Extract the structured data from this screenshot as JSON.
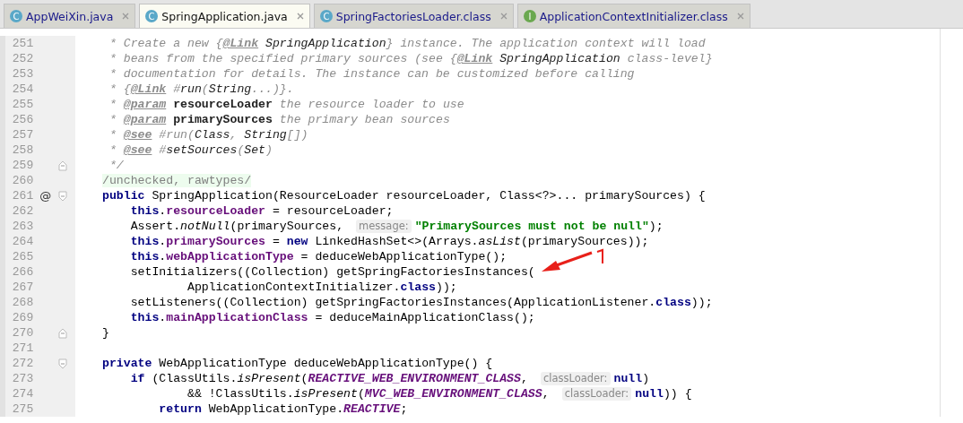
{
  "tabs": [
    {
      "label": "AppWeiXin.java",
      "icon_letter": "C",
      "kind": "class",
      "selected": false
    },
    {
      "label": "SpringApplication.java",
      "icon_letter": "C",
      "kind": "class",
      "selected": true
    },
    {
      "label": "SpringFactoriesLoader.class",
      "icon_letter": "C",
      "kind": "class",
      "selected": false
    },
    {
      "label": "ApplicationContextInitializer.class",
      "icon_letter": "I",
      "kind": "interface",
      "selected": false
    }
  ],
  "lines": [
    {
      "number": "251",
      "tokens": [
        {
          "t": " * Create a new {",
          "kind": "comment"
        },
        {
          "t": "@Link",
          "kind": "doctag"
        },
        {
          "t": " SpringApplication",
          "kind": "docref"
        },
        {
          "t": "} instance. The application context will load",
          "kind": "comment"
        }
      ]
    },
    {
      "number": "252",
      "tokens": [
        {
          "t": " * beans from the specified primary sources (see {",
          "kind": "comment"
        },
        {
          "t": "@Link",
          "kind": "doctag"
        },
        {
          "t": " SpringApplication",
          "kind": "docref"
        },
        {
          "t": " class-level}",
          "kind": "comment"
        }
      ]
    },
    {
      "number": "253",
      "tokens": [
        {
          "t": " * documentation for details. The instance can be customized before calling",
          "kind": "comment"
        }
      ]
    },
    {
      "number": "254",
      "tokens": [
        {
          "t": " * {",
          "kind": "comment"
        },
        {
          "t": "@Link",
          "kind": "doctag"
        },
        {
          "t": " #",
          "kind": "comment"
        },
        {
          "t": "run",
          "kind": "docref"
        },
        {
          "t": "(",
          "kind": "comment"
        },
        {
          "t": "String",
          "kind": "docref"
        },
        {
          "t": "...)}.",
          "kind": "comment"
        }
      ]
    },
    {
      "number": "255",
      "tokens": [
        {
          "t": " * ",
          "kind": "comment"
        },
        {
          "t": "@param",
          "kind": "doctag"
        },
        {
          "t": " resourceLoader",
          "kind": "docparam"
        },
        {
          "t": " the resource loader to use",
          "kind": "comment"
        }
      ]
    },
    {
      "number": "256",
      "tokens": [
        {
          "t": " * ",
          "kind": "comment"
        },
        {
          "t": "@param",
          "kind": "doctag"
        },
        {
          "t": " primarySources",
          "kind": "docparam"
        },
        {
          "t": " the primary bean sources",
          "kind": "comment"
        }
      ]
    },
    {
      "number": "257",
      "tokens": [
        {
          "t": " * ",
          "kind": "comment"
        },
        {
          "t": "@see",
          "kind": "doctag"
        },
        {
          "t": " #run(",
          "kind": "comment"
        },
        {
          "t": "Class",
          "kind": "docref"
        },
        {
          "t": ", ",
          "kind": "comment"
        },
        {
          "t": "String",
          "kind": "docref"
        },
        {
          "t": "[])",
          "kind": "comment"
        }
      ]
    },
    {
      "number": "258",
      "tokens": [
        {
          "t": " * ",
          "kind": "comment"
        },
        {
          "t": "@see",
          "kind": "doctag"
        },
        {
          "t": " #",
          "kind": "comment"
        },
        {
          "t": "setSources",
          "kind": "docref"
        },
        {
          "t": "(",
          "kind": "comment"
        },
        {
          "t": "Set",
          "kind": "docref"
        },
        {
          "t": ")",
          "kind": "comment"
        }
      ]
    },
    {
      "number": "259",
      "fold": {
        "kind": "end"
      },
      "tokens": [
        {
          "t": " */",
          "kind": "comment"
        }
      ]
    },
    {
      "number": "260",
      "tokens": [
        {
          "t": "/unchecked, rawtypes/",
          "kind": "annotation"
        }
      ]
    },
    {
      "number": "261",
      "gutter_mark": "@",
      "fold": {
        "kind": "start"
      },
      "tokens": [
        {
          "t": "public",
          "kind": "keyword"
        },
        {
          "t": " SpringApplication(ResourceLoader resourceLoader, Class<?>... primarySources) {",
          "kind": "plain"
        }
      ]
    },
    {
      "number": "262",
      "tokens": [
        {
          "t": "    this",
          "kind": "keyword"
        },
        {
          "t": ".",
          "kind": "plain"
        },
        {
          "t": "resourceLoader",
          "kind": "field"
        },
        {
          "t": " = resourceLoader;",
          "kind": "plain"
        }
      ]
    },
    {
      "number": "263",
      "tokens": [
        {
          "t": "    Assert.",
          "kind": "plain"
        },
        {
          "t": "notNull",
          "kind": "method"
        },
        {
          "t": "(primarySources,",
          "kind": "plain"
        },
        {
          "t": "message:",
          "kind": "hint"
        },
        {
          "t": "\"PrimarySources must not be null\"",
          "kind": "string"
        },
        {
          "t": ");",
          "kind": "plain"
        }
      ]
    },
    {
      "number": "264",
      "tokens": [
        {
          "t": "    this",
          "kind": "keyword"
        },
        {
          "t": ".",
          "kind": "plain"
        },
        {
          "t": "primarySources",
          "kind": "field"
        },
        {
          "t": " = ",
          "kind": "plain"
        },
        {
          "t": "new",
          "kind": "keyword"
        },
        {
          "t": " LinkedHashSet<>(Arrays.",
          "kind": "plain"
        },
        {
          "t": "asList",
          "kind": "method"
        },
        {
          "t": "(primarySources));",
          "kind": "plain"
        }
      ]
    },
    {
      "number": "265",
      "tokens": [
        {
          "t": "    this",
          "kind": "keyword"
        },
        {
          "t": ".",
          "kind": "plain"
        },
        {
          "t": "webApplicationType",
          "kind": "field"
        },
        {
          "t": " = deduceWebApplicationType();",
          "kind": "plain"
        }
      ]
    },
    {
      "number": "266",
      "tokens": [
        {
          "t": "    setInitializers((Collection) getSpringFactoriesInstances(",
          "kind": "plain"
        }
      ]
    },
    {
      "number": "267",
      "tokens": [
        {
          "t": "            ApplicationContextInitializer.",
          "kind": "plain"
        },
        {
          "t": "class",
          "kind": "keyword"
        },
        {
          "t": "));",
          "kind": "plain"
        }
      ]
    },
    {
      "number": "268",
      "tokens": [
        {
          "t": "    setListeners((Collection) getSpringFactoriesInstances(ApplicationListener.",
          "kind": "plain"
        },
        {
          "t": "class",
          "kind": "keyword"
        },
        {
          "t": "));",
          "kind": "plain"
        }
      ]
    },
    {
      "number": "269",
      "tokens": [
        {
          "t": "    this",
          "kind": "keyword"
        },
        {
          "t": ".",
          "kind": "plain"
        },
        {
          "t": "mainApplicationClass",
          "kind": "field"
        },
        {
          "t": " = deduceMainApplicationClass();",
          "kind": "plain"
        }
      ]
    },
    {
      "number": "270",
      "fold": {
        "kind": "end"
      },
      "tokens": [
        {
          "t": "}",
          "kind": "plain"
        }
      ]
    },
    {
      "number": "271"
    },
    {
      "number": "272",
      "fold": {
        "kind": "start"
      },
      "tokens": [
        {
          "t": "private",
          "kind": "keyword"
        },
        {
          "t": " WebApplicationType deduceWebApplicationType() {",
          "kind": "plain"
        }
      ]
    },
    {
      "number": "273",
      "tokens": [
        {
          "t": "    if",
          "kind": "keyword"
        },
        {
          "t": " (ClassUtils.",
          "kind": "plain"
        },
        {
          "t": "isPresent",
          "kind": "method"
        },
        {
          "t": "(",
          "kind": "plain"
        },
        {
          "t": "REACTIVE_WEB_ENVIRONMENT_CLASS",
          "kind": "static"
        },
        {
          "t": ",",
          "kind": "plain"
        },
        {
          "t": "classLoader:",
          "kind": "hint"
        },
        {
          "t": "null",
          "kind": "keyword"
        },
        {
          "t": ")",
          "kind": "plain"
        }
      ]
    },
    {
      "number": "274",
      "tokens": [
        {
          "t": "            && !ClassUtils.",
          "kind": "plain"
        },
        {
          "t": "isPresent",
          "kind": "method"
        },
        {
          "t": "(",
          "kind": "plain"
        },
        {
          "t": "MVC_WEB_ENVIRONMENT_CLASS",
          "kind": "static"
        },
        {
          "t": ",",
          "kind": "plain"
        },
        {
          "t": "classLoader:",
          "kind": "hint"
        },
        {
          "t": "null",
          "kind": "keyword"
        },
        {
          "t": ")) {",
          "kind": "plain"
        }
      ]
    },
    {
      "number": "275",
      "tokens": [
        {
          "t": "        return",
          "kind": "keyword"
        },
        {
          "t": " WebApplicationType.",
          "kind": "plain"
        },
        {
          "t": "REACTIVE",
          "kind": "static"
        },
        {
          "t": ";",
          "kind": "plain"
        }
      ]
    }
  ]
}
